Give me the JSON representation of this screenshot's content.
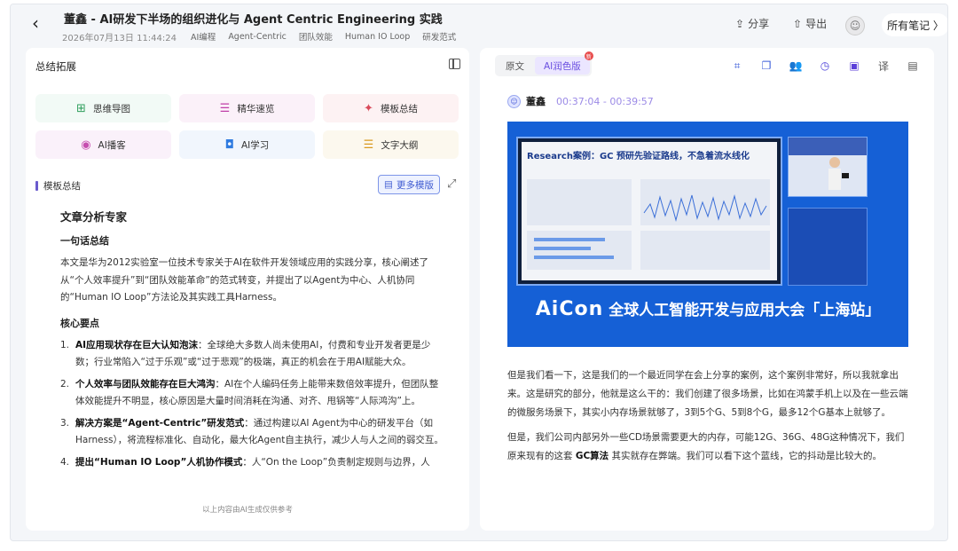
{
  "header": {
    "title": "董鑫 - AI研发下半场的组织进化与 Agent Centric Engineering 实践",
    "date": "2026年07月13日 11:44:24",
    "tags": [
      "AI编程",
      "Agent-Centric",
      "团队效能",
      "Human IO Loop",
      "研发范式"
    ],
    "share_label": "分享",
    "export_label": "导出",
    "all_notes_label": "所有笔记 〉"
  },
  "left": {
    "panel_title": "总结拓展",
    "tools": [
      {
        "label": "思维导图",
        "icon": "mindmap-icon",
        "glyph": "⊞",
        "color": "#2f9e5c",
        "bg": "#f2faf6"
      },
      {
        "label": "精华速览",
        "icon": "highlight-list-icon",
        "glyph": "☰",
        "color": "#c040a8",
        "bg": "#fbf1f9"
      },
      {
        "label": "模板总结",
        "icon": "sparkle-icon",
        "glyph": "✦",
        "color": "#d94a5a",
        "bg": "#fdf2f3"
      },
      {
        "label": "AI播客",
        "icon": "podcast-icon",
        "glyph": "◉",
        "color": "#c64fb0",
        "bg": "#faf1fa"
      },
      {
        "label": "AI学习",
        "icon": "ai-learn-icon",
        "glyph": "◘",
        "color": "#2f7be0",
        "bg": "#f1f6fd"
      },
      {
        "label": "文字大纲",
        "icon": "outline-icon",
        "glyph": "☰",
        "color": "#d99a20",
        "bg": "#fcf8ee"
      }
    ],
    "section_title": "模板总结",
    "more_templates_label": "更多模版",
    "article": {
      "heading": "文章分析专家",
      "summary_title": "一句话总结",
      "summary": "本文是华为2012实验室一位技术专家关于AI在软件开发领域应用的实践分享，核心阐述了从“个人效率提升”到“团队效能革命”的范式转变，并提出了以Agent为中心、人机协同的“Human IO Loop”方法论及其实践工具Harness。",
      "points_title": "核心要点",
      "points": [
        {
          "num": "1.",
          "bold": "AI应用现状存在巨大认知泡沫",
          "text": "：全球绝大多数人尚未使用AI，付费和专业开发者更是少数；行业常陷入“过于乐观”或“过于悲观”的极端，真正的机会在于用AI赋能大众。"
        },
        {
          "num": "2.",
          "bold": "个人效率与团队效能存在巨大鸿沟",
          "text": "：AI在个人编码任务上能带来数倍效率提升，但团队整体效能提升不明显，核心原因是大量时间消耗在沟通、对齐、甩锅等“人际鸿沟”上。"
        },
        {
          "num": "3.",
          "bold": "解决方案是“Agent-Centric”研发范式",
          "text": "：通过构建以AI Agent为中心的研发平台（如Harness），将流程标准化、自动化，最大化Agent自主执行，减少人与人之间的弱交互。"
        },
        {
          "num": "4.",
          "bold": "提出“Human IO Loop”人机协作模式",
          "text": "：人“On the Loop”负责制定规则与边界，人"
        }
      ]
    },
    "footnote": "以上内容由AI生成仅供参考"
  },
  "right": {
    "tabs": [
      {
        "label": "原文",
        "active": false
      },
      {
        "label": "AI润色版",
        "active": true,
        "badge": "新"
      }
    ],
    "toolbar_icons": [
      {
        "name": "scan-icon",
        "glyph": "⌗",
        "color": "#3a5bd9"
      },
      {
        "name": "copy-icon",
        "glyph": "❐",
        "color": "#3a5bd9"
      },
      {
        "name": "speakers-icon",
        "glyph": "👥",
        "color": "#5b3fd9"
      },
      {
        "name": "clock-icon",
        "glyph": "◷",
        "color": "#4a3fd9"
      },
      {
        "name": "image-icon",
        "glyph": "▣",
        "color": "#5b3fd9"
      },
      {
        "name": "translate-icon",
        "glyph": "译",
        "color": "#555"
      },
      {
        "name": "document-icon",
        "glyph": "▤",
        "color": "#555"
      }
    ],
    "speaker": {
      "name": "董鑫",
      "time": "00:37:04 - 00:39:57"
    },
    "slide": {
      "screen_title": "Research案例：GC 预研先验证路线，不急着流水线化",
      "brand": "AiCon",
      "banner_text": "全球人工智能开发与应用大会「上海站」"
    },
    "paragraphs": [
      {
        "before": "但是我们看一下，这是我们的一个最近同学在会上分享的案例，这个案例非常好，所以我就拿出来。这是研究的部分，他就是这么干的：我们创建了很多场景，比如在鸿蒙手机上以及在一些云端的微服务场景下，其实小内存场景就够了，3到5个G、5到8个G，最多12个G基本上就够了。",
        "bold": "",
        "after": ""
      },
      {
        "before": "但是，我们公司内部另外一些CD场景需要更大的内存，可能12G、36G、48G这种情况下，我们原来现有的这套 ",
        "bold": "GC算法",
        "after": " 其实就存在弊端。我们可以看下这个蓝线，它的抖动是比较大的。"
      }
    ]
  }
}
